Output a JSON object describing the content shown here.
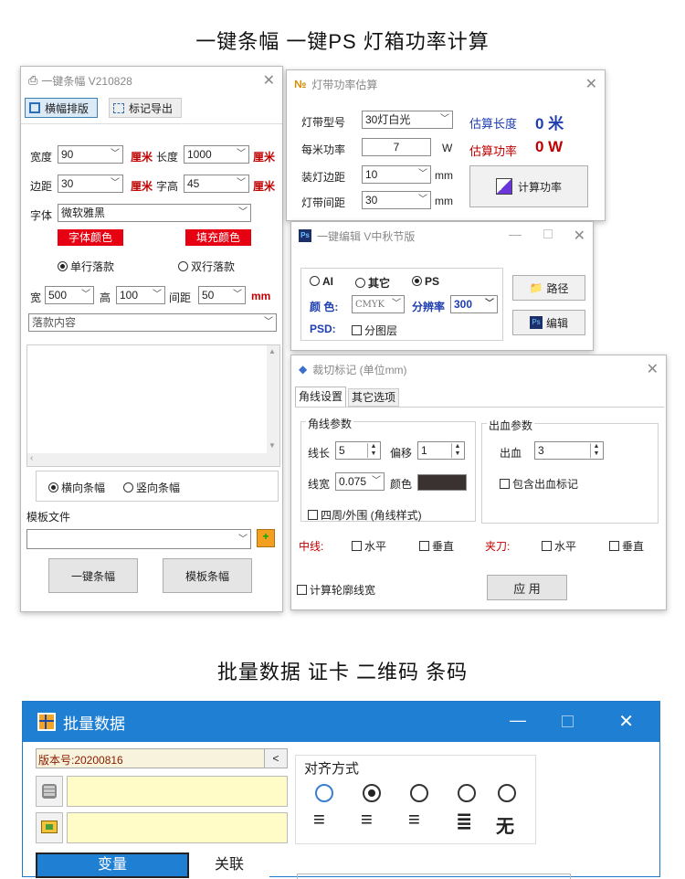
{
  "section1_title": "一键条幅 一键PS 灯箱功率计算",
  "section2_title": "批量数据 证卡 二维码 条码",
  "banner": {
    "title": "一键条幅 V210828",
    "tab_layout": "横幅排版",
    "tab_export": "标记导出",
    "width_label": "宽度",
    "width_value": "90",
    "unit_cm": "厘米",
    "length_label": "长度",
    "length_value": "1000",
    "margin_label": "边距",
    "margin_value": "30",
    "charheight_label": "字高",
    "charheight_value": "45",
    "font_label": "字体",
    "font_value": "微软雅黑",
    "font_color": "字体颜色",
    "fill_color": "填充颜色",
    "single_line": "单行落款",
    "double_line": "双行落款",
    "w_label": "宽",
    "w_value": "500",
    "h_label": "高",
    "h_value": "100",
    "gap_label": "间距",
    "gap_value": "50",
    "unit_mm": "mm",
    "signature_placeholder": "落款内容",
    "horizontal": "横向条幅",
    "vertical": "竖向条幅",
    "template_label": "模板文件",
    "btn_one_click": "一键条幅",
    "btn_template": "模板条幅"
  },
  "led": {
    "title": "灯带功率估算",
    "model_label": "灯带型号",
    "model_value": "30灯白光",
    "power_label": "每米功率",
    "power_value": "7",
    "power_unit": "W",
    "spacing_label": "装灯边距",
    "spacing_value": "10",
    "interval_label": "灯带间距",
    "interval_value": "30",
    "unit": "mm",
    "est_length_label": "估算长度",
    "est_length_value": "0 米",
    "est_power_label": "估算功率",
    "est_power_value": "0 W",
    "calc_button": "计算功率"
  },
  "ps": {
    "title": "一键编辑 V中秋节版",
    "opt_ai": "AI",
    "opt_other": "其它",
    "opt_ps": "PS",
    "color_label": "颜 色:",
    "color_value": "CMYK",
    "res_label": "分辨率",
    "res_value": "300",
    "psd_label": "PSD:",
    "layers_label": "分图层",
    "path_button": "路径",
    "edit_button": "编辑"
  },
  "crop": {
    "title": "裁切标记 (单位mm)",
    "tab1": "角线设置",
    "tab2": "其它选项",
    "corner_group": "角线参数",
    "len_label": "线长",
    "len_value": "5",
    "offset_label": "偏移",
    "offset_value": "1",
    "width_label": "线宽",
    "width_value": "0.075",
    "color_label": "颜色",
    "style_label": "四周/外围 (角线样式)",
    "bleed_group": "出血参数",
    "bleed_label": "出血",
    "bleed_value": "3",
    "include_bleed": "包含出血标记",
    "center_label": "中线:",
    "horizontal": "水平",
    "vertical": "垂直",
    "clamp_label": "夹刀:",
    "calc_outline": "计算轮廓线宽",
    "apply_button": "应 用",
    "swatch_color": "#3a3230"
  },
  "batch": {
    "title": "批量数据",
    "version": "版本号:20200816",
    "collapse_button": "<",
    "align_label": "对齐方式",
    "align_none": "无",
    "tab_variable": "变量",
    "tab_link": "关联"
  }
}
